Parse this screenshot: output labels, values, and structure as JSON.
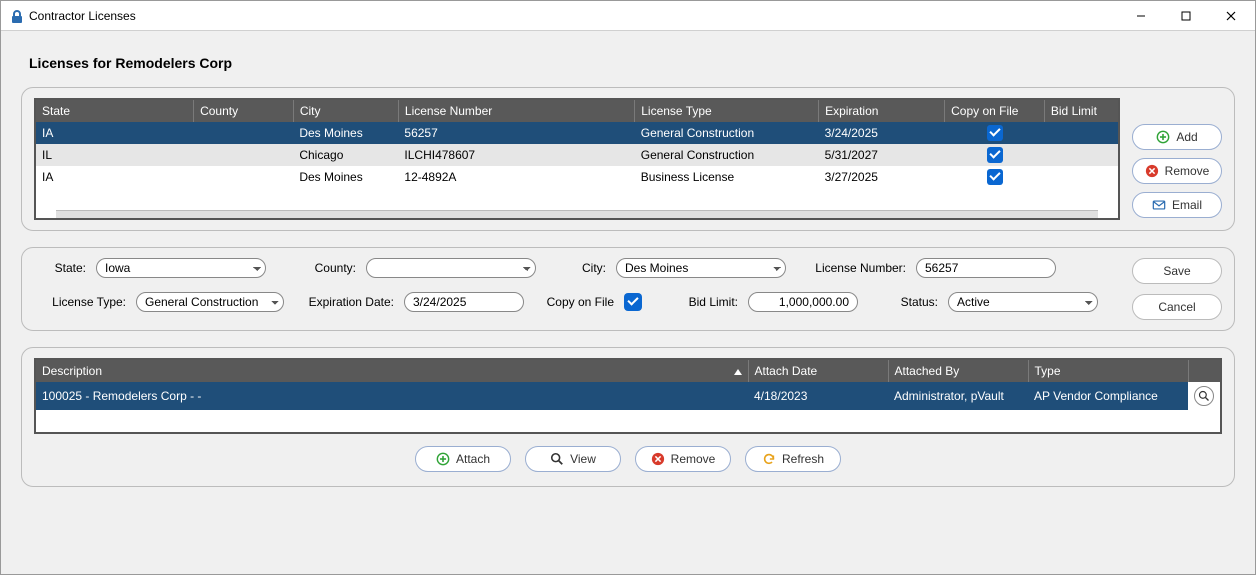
{
  "window": {
    "title": "Contractor Licenses"
  },
  "page": {
    "heading": "Licenses for Remodelers Corp"
  },
  "licenses": {
    "columns": [
      "State",
      "County",
      "City",
      "License Number",
      "License Type",
      "Expiration",
      "Copy on File",
      "Bid Limit"
    ],
    "rows": [
      {
        "state": "IA",
        "county": "",
        "city": "Des Moines",
        "num": "56257",
        "type": "General Construction",
        "exp": "3/24/2025",
        "copy": true,
        "bid": ""
      },
      {
        "state": "IL",
        "county": "",
        "city": "Chicago",
        "num": "ILCHI478607",
        "type": "General Construction",
        "exp": "5/31/2027",
        "copy": true,
        "bid": ""
      },
      {
        "state": "IA",
        "county": "",
        "city": "Des Moines",
        "num": "12-4892A",
        "type": "Business License",
        "exp": "3/27/2025",
        "copy": true,
        "bid": ""
      }
    ],
    "side_buttons": {
      "add": "Add",
      "remove": "Remove",
      "email": "Email"
    }
  },
  "form": {
    "labels": {
      "state": "State:",
      "county": "County:",
      "city": "City:",
      "license_number": "License Number:",
      "license_type": "License Type:",
      "expiration": "Expiration Date:",
      "copy": "Copy on File",
      "bid": "Bid Limit:",
      "status": "Status:"
    },
    "values": {
      "state": "Iowa",
      "county": "",
      "city": "Des Moines",
      "license_number": "56257",
      "license_type": "General Construction",
      "expiration": "3/24/2025",
      "bid": "1,000,000.00",
      "status": "Active"
    },
    "buttons": {
      "save": "Save",
      "cancel": "Cancel"
    }
  },
  "attachments": {
    "columns": {
      "desc": "Description",
      "date": "Attach Date",
      "by": "Attached By",
      "type": "Type"
    },
    "rows": [
      {
        "desc": "100025 - Remodelers Corp -  -",
        "date": "4/18/2023",
        "by": "Administrator, pVault",
        "type": "AP Vendor Compliance"
      }
    ],
    "buttons": {
      "attach": "Attach",
      "view": "View",
      "remove": "Remove",
      "refresh": "Refresh"
    }
  }
}
